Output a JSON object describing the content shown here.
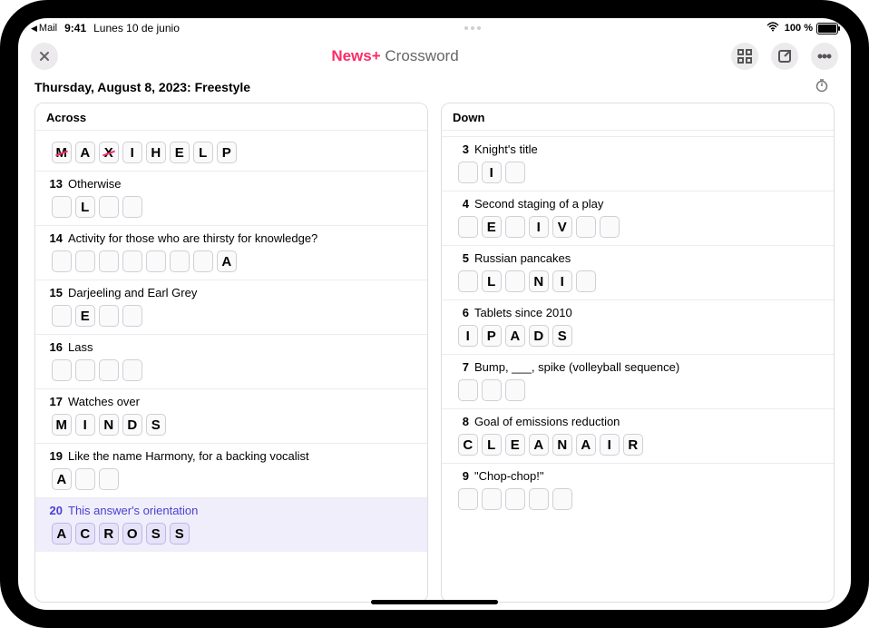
{
  "status": {
    "back_app": "Mail",
    "time": "9:41",
    "date": "Lunes 10 de junio",
    "battery_pct": "100 %"
  },
  "header": {
    "brand": "News+",
    "page": "Crossword"
  },
  "subtitle": "Thursday, August 8, 2023: Freestyle",
  "across": {
    "label": "Across",
    "clues": [
      {
        "num": "",
        "text": "",
        "cells": [
          "M",
          "A",
          "X",
          "I",
          "H",
          "E",
          "L",
          "P"
        ],
        "wrong_idx": [
          0,
          2
        ],
        "hide_header": true
      },
      {
        "num": "13",
        "text": "Otherwise",
        "cells": [
          "",
          "L",
          "",
          ""
        ]
      },
      {
        "num": "14",
        "text": "Activity for those who are thirsty for knowledge?",
        "cells": [
          "",
          "",
          "",
          "",
          "",
          "",
          "",
          "A"
        ]
      },
      {
        "num": "15",
        "text": "Darjeeling and Earl Grey",
        "cells": [
          "",
          "E",
          "",
          ""
        ]
      },
      {
        "num": "16",
        "text": "Lass",
        "cells": [
          "",
          "",
          "",
          ""
        ]
      },
      {
        "num": "17",
        "text": "Watches over",
        "cells": [
          "M",
          "I",
          "N",
          "D",
          "S"
        ]
      },
      {
        "num": "19",
        "text": "Like the name Harmony, for a backing vocalist",
        "cells": [
          "A",
          "",
          ""
        ]
      },
      {
        "num": "20",
        "text": "This answer's orientation",
        "cells": [
          "A",
          "C",
          "R",
          "O",
          "S",
          "S"
        ],
        "selected": true
      }
    ]
  },
  "down": {
    "label": "Down",
    "clues": [
      {
        "num": "3",
        "text": "Knight's title",
        "cells": [
          "",
          "I",
          ""
        ]
      },
      {
        "num": "4",
        "text": "Second staging of a play",
        "cells": [
          "",
          "E",
          "",
          "I",
          "V",
          "",
          ""
        ]
      },
      {
        "num": "5",
        "text": "Russian pancakes",
        "cells": [
          "",
          "L",
          "",
          "N",
          "I",
          ""
        ]
      },
      {
        "num": "6",
        "text": "Tablets since 2010",
        "cells": [
          "I",
          "P",
          "A",
          "D",
          "S"
        ]
      },
      {
        "num": "7",
        "text": "Bump, ___, spike (volleyball sequence)",
        "cells": [
          "",
          "",
          ""
        ]
      },
      {
        "num": "8",
        "text": "Goal of emissions reduction",
        "cells": [
          "C",
          "L",
          "E",
          "A",
          "N",
          "A",
          "I",
          "R"
        ]
      },
      {
        "num": "9",
        "text": "\"Chop-chop!\"",
        "cells": [
          "",
          "",
          "",
          "",
          ""
        ]
      }
    ]
  }
}
